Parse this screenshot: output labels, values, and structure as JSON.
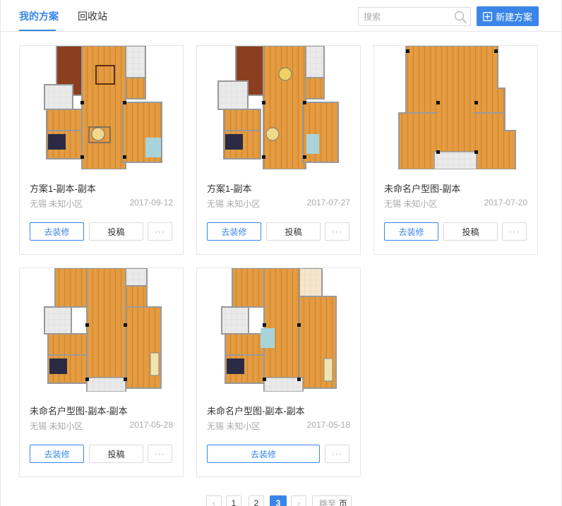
{
  "header": {
    "tabs": [
      {
        "label": "我的方案",
        "active": true
      },
      {
        "label": "回收站",
        "active": false
      }
    ],
    "search_placeholder": "搜索",
    "new_button": "新建方案",
    "accent_color": "#3a86e8"
  },
  "card_actions": {
    "edit": "去装修",
    "submit": "投稿",
    "more": "···"
  },
  "cards": [
    {
      "title": "方案1-副本-副本",
      "location": "无锡 未知小区",
      "date": "2017-09-12"
    },
    {
      "title": "方案1-副本",
      "location": "无锡 未知小区",
      "date": "2017-07-27"
    },
    {
      "title": "未命名户型图-副本",
      "location": "无锡 未知小区",
      "date": "2017-07-20"
    },
    {
      "title": "未命名户型图-副本-副本",
      "location": "无锡 未知小区",
      "date": "2017-05-28"
    },
    {
      "title": "未命名户型图-副本-副本",
      "location": "无锡 未知小区",
      "date": "2017-05-18"
    }
  ],
  "pagination": {
    "prev": "‹",
    "pages": [
      "1",
      "2",
      "3"
    ],
    "current": "3",
    "next": "›",
    "goto_prefix": "跳至",
    "goto_suffix": "页"
  }
}
